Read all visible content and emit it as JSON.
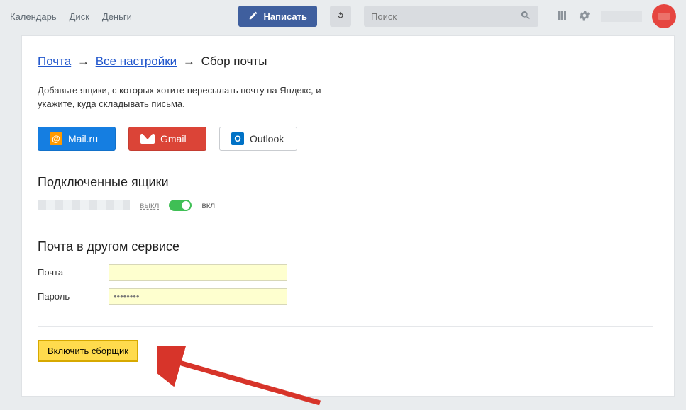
{
  "header": {
    "nav": {
      "calendar": "Календарь",
      "disk": "Диск",
      "money": "Деньги"
    },
    "compose": "Написать",
    "search_placeholder": "Поиск"
  },
  "breadcrumb": {
    "mail": "Почта",
    "all_settings": "Все настройки",
    "current": "Сбор почты",
    "arrow": "→"
  },
  "description": "Добавьте ящики, с которых хотите пересылать почту на Яндекс, и укажите, куда складывать письма.",
  "providers": {
    "mailru": "Mail.ru",
    "gmail": "Gmail",
    "outlook": "Outlook"
  },
  "connected": {
    "heading": "Подключенные ящики",
    "off": "выкл",
    "on": "вкл"
  },
  "external": {
    "heading": "Почта в другом сервисе",
    "mail_label": "Почта",
    "pass_label": "Пароль",
    "mail_value": "",
    "pass_value": "••••••••"
  },
  "submit_label": "Включить сборщик"
}
